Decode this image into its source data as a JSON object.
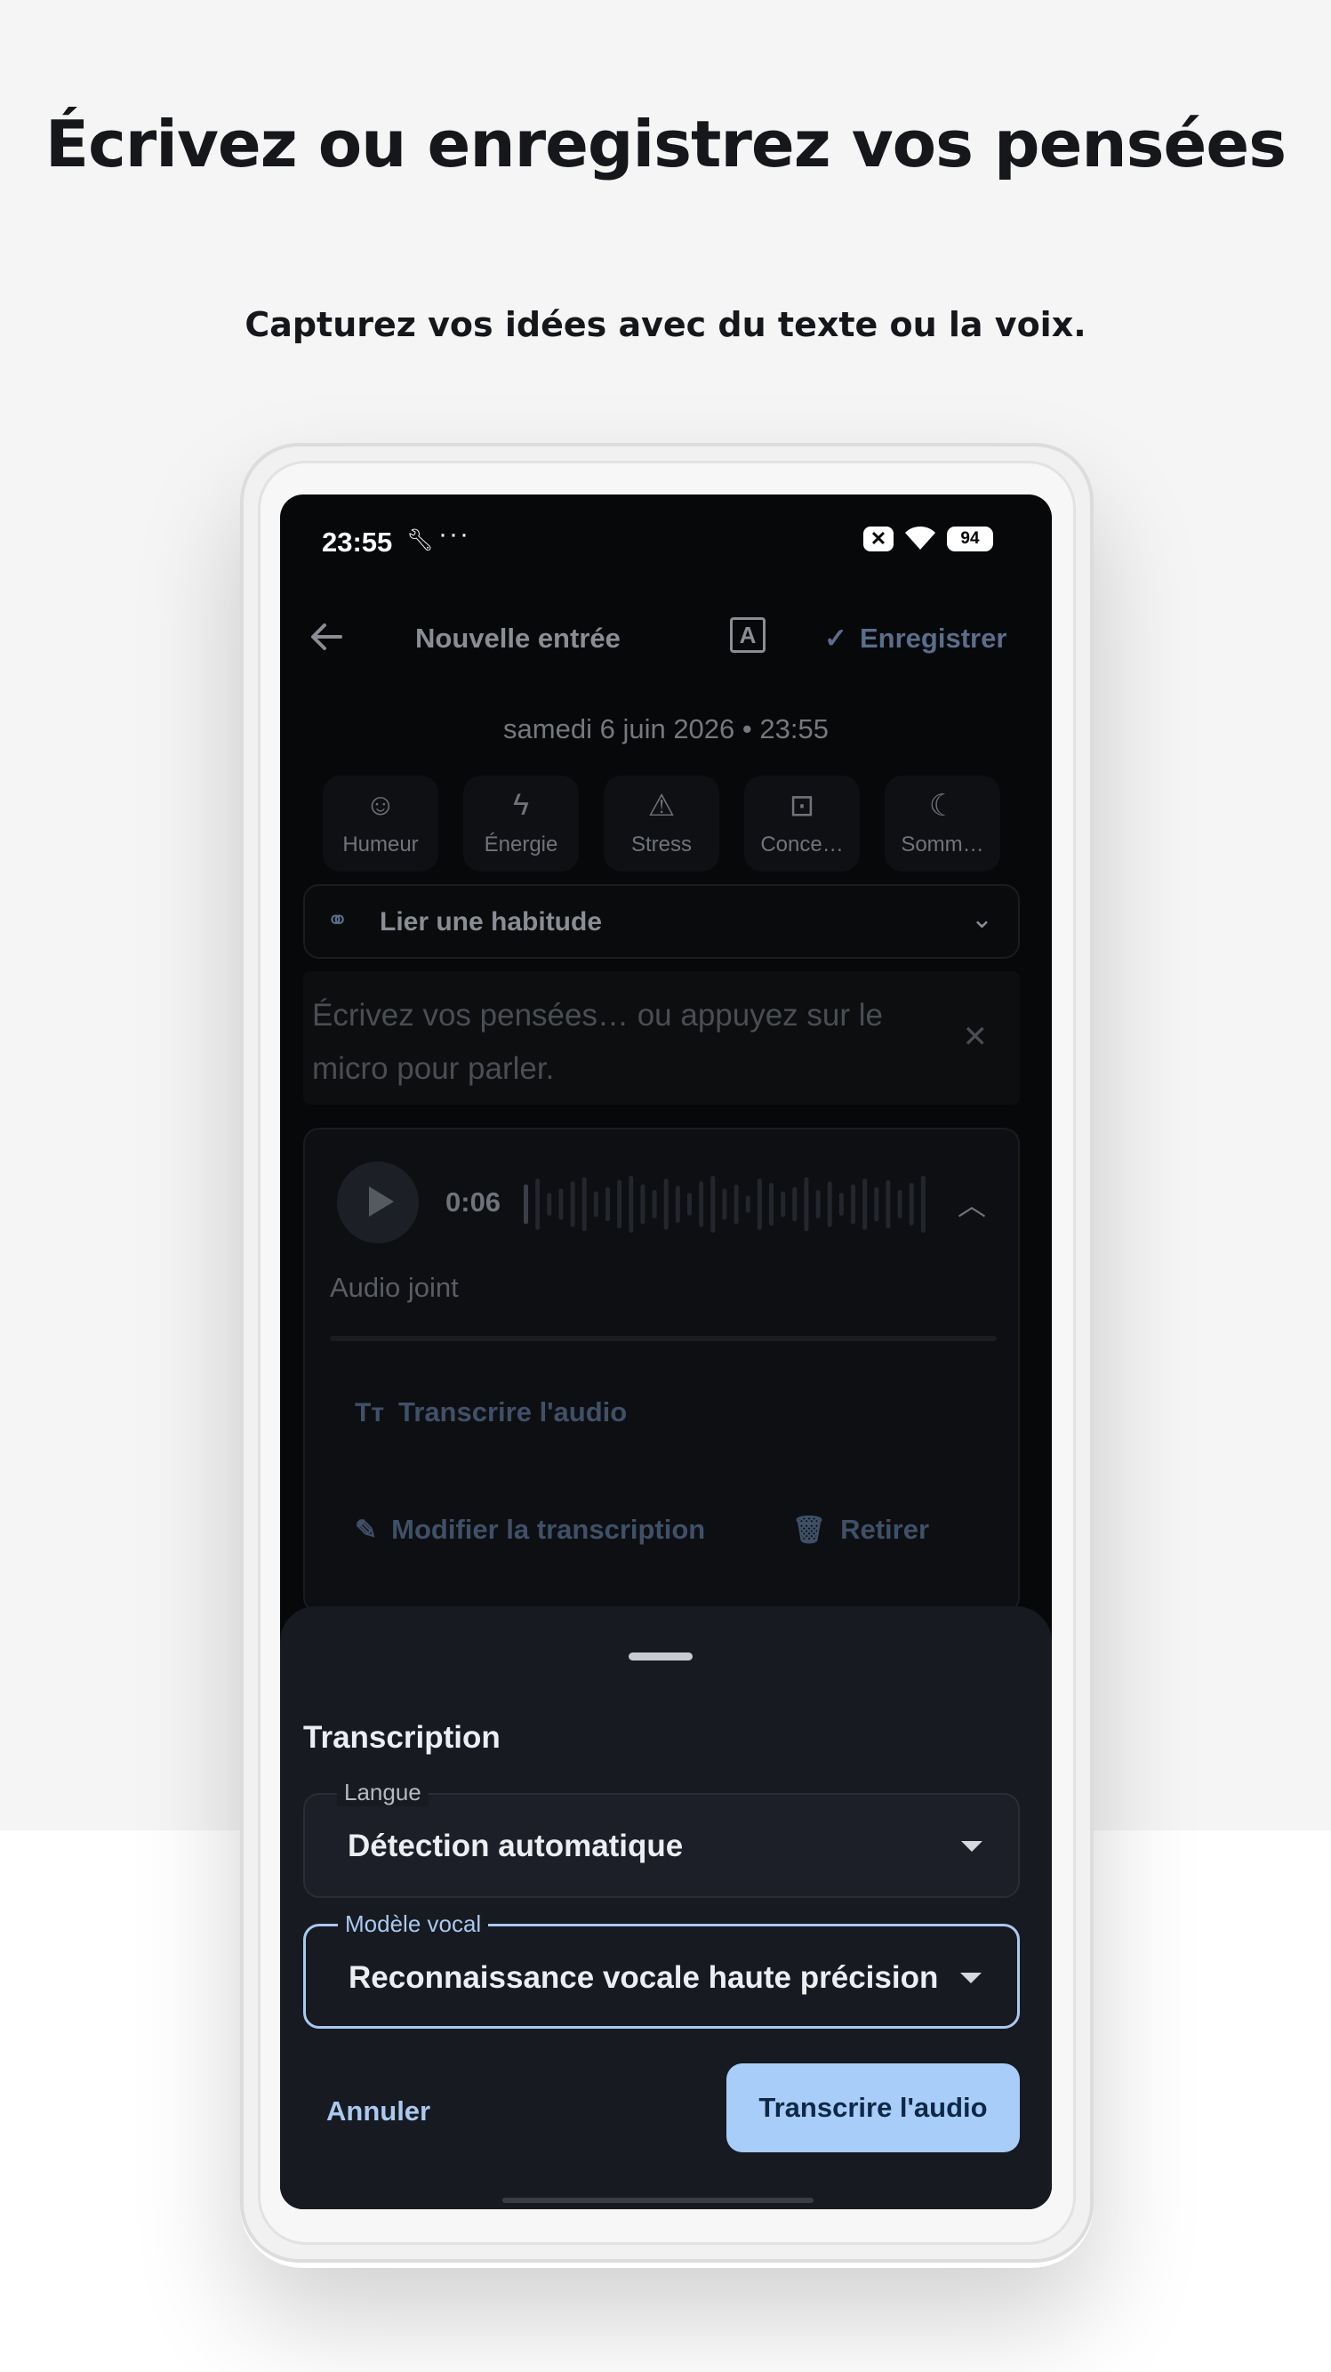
{
  "headline": "Écrivez ou enregistrez vos pensées",
  "subline": "Capturez vos idées avec du texte ou la voix.",
  "status_bar": {
    "time": "23:55",
    "dots": "···",
    "battery": "94"
  },
  "app_bar": {
    "title": "Nouvelle entrée",
    "format_icon_label": "A",
    "save_label": "Enregistrer"
  },
  "entry": {
    "datetime": "samedi 6 juin 2026 • 23:55",
    "metrics": [
      {
        "label": "Humeur",
        "icon": "smiley-icon"
      },
      {
        "label": "Énergie",
        "icon": "bolt-icon"
      },
      {
        "label": "Stress",
        "icon": "warning-icon"
      },
      {
        "label": "Conce…",
        "icon": "focus-icon"
      },
      {
        "label": "Somm…",
        "icon": "moon-icon"
      }
    ],
    "habit_link": "Lier une habitude",
    "text_placeholder": "Écrivez vos pensées… ou appuyez sur le micro pour parler."
  },
  "audio": {
    "duration": "0:06",
    "label": "Audio joint",
    "transcribe": "Transcrire l'audio",
    "edit_transcription": "Modifier la transcription",
    "remove": "Retirer"
  },
  "sheet": {
    "title": "Transcription",
    "language_label": "Langue",
    "language_value": "Détection automatique",
    "model_label": "Modèle vocal",
    "model_value": "Reconnaissance vocale haute précision",
    "cancel": "Annuler",
    "confirm": "Transcrire l'audio"
  },
  "colors": {
    "background_top": "#f5f5f6",
    "screen": "#070809",
    "sheet": "#171a21",
    "accent": "#a8cdf9",
    "muted_blue": "#5a6d8b"
  }
}
